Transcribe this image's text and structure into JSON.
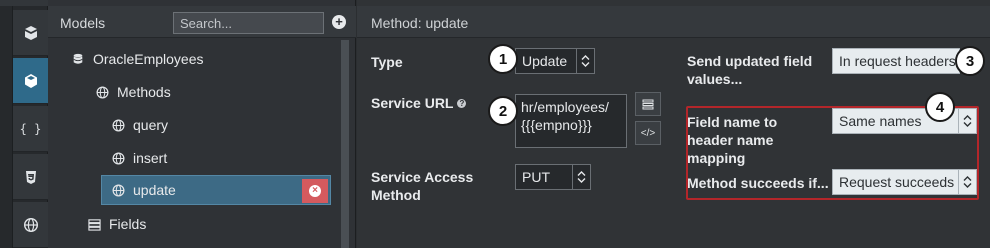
{
  "models_panel": {
    "title": "Models",
    "search_placeholder": "Search...",
    "add_symbol": "+",
    "tree": [
      {
        "label": "OracleEmployees",
        "icon": "database-icon"
      },
      {
        "label": "Methods",
        "icon": "globe-icon"
      },
      {
        "label": "query",
        "icon": "globe-icon"
      },
      {
        "label": "insert",
        "icon": "globe-icon"
      },
      {
        "label": "update",
        "icon": "globe-icon",
        "selected": true
      },
      {
        "label": "Fields",
        "icon": "fields-icon"
      }
    ],
    "delete_symbol": "×"
  },
  "rail": {
    "items": [
      {
        "icon": "cube-stack-icon"
      },
      {
        "icon": "cube-icon",
        "active": true
      },
      {
        "icon": "braces-icon"
      },
      {
        "icon": "css3-icon"
      },
      {
        "icon": "globe-icon"
      }
    ],
    "braces_text": "{ }"
  },
  "method_panel": {
    "title": "Method: update",
    "type_label": "Type",
    "type_value": "Update",
    "service_url_label": "Service URL",
    "service_url_value": "hr/employees/{{{empno}}}",
    "service_access_label": "Service Access Method",
    "service_access_value": "PUT",
    "send_updated_label": "Send updated field values...",
    "send_updated_value": "In request headers",
    "field_mapping_label": "Field name to header name mapping",
    "field_mapping_value": "Same names",
    "method_succeeds_label": "Method succeeds if...",
    "method_succeeds_value": "Request succeeds",
    "code_btn_text": "</>"
  },
  "callouts": [
    "1",
    "2",
    "3",
    "4"
  ],
  "colors": {
    "accent": "#2f6a8a",
    "selected_row": "#3d6a85",
    "delete": "#d45a5e",
    "highlight": "#b3262a"
  }
}
